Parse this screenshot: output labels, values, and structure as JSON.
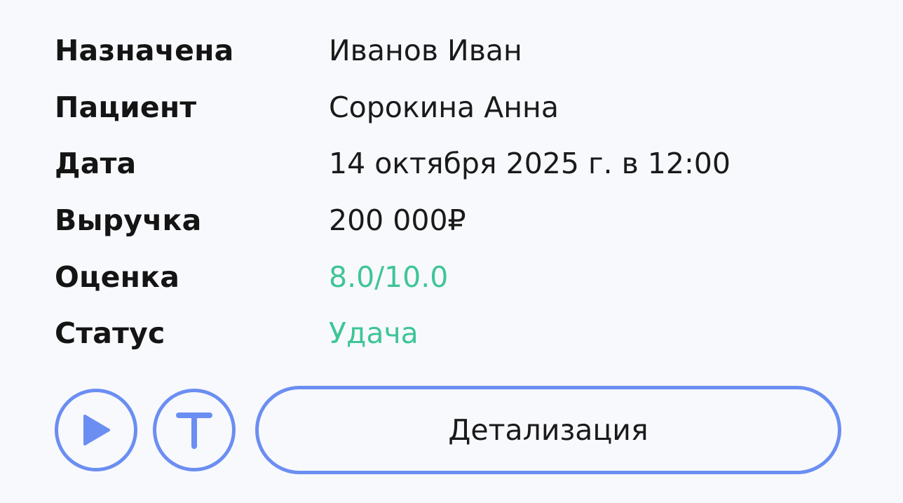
{
  "details": {
    "rows": [
      {
        "label": "Назначена",
        "value": "Иванов Иван"
      },
      {
        "label": "Пациент",
        "value": "Сорокина Анна"
      },
      {
        "label": "Дата",
        "value": "14 октября 2025 г. в 12:00"
      },
      {
        "label": "Выручка",
        "value": "200 000₽"
      },
      {
        "label": "Оценка",
        "value": "8.0/10.0"
      },
      {
        "label": "Статус",
        "value": "Удача"
      }
    ]
  },
  "actions": {
    "play_icon": "play-icon",
    "transcript_icon": "letter-t-icon",
    "details_label": "Детализация"
  },
  "colors": {
    "accent": "#6b8ef2",
    "success": "#3fc596",
    "background": "#f8f9fd",
    "text": "#141414"
  }
}
